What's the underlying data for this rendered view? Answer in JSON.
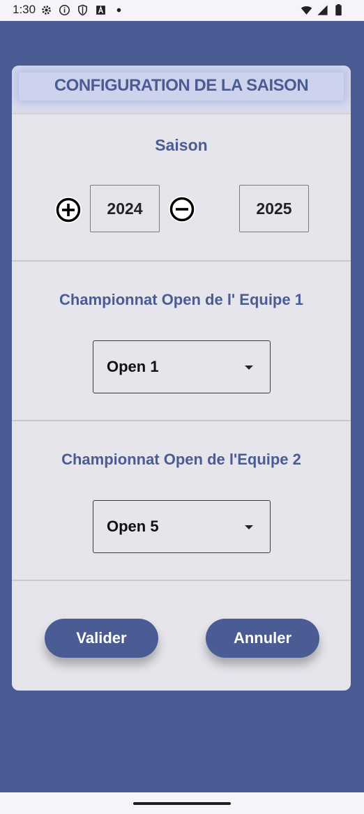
{
  "status_bar": {
    "time": "1:30",
    "left_icons": [
      "settings-icon",
      "info-icon",
      "shield-icon",
      "a-box-icon",
      "dot-icon"
    ],
    "right_icons": [
      "wifi-icon",
      "signal-icon",
      "battery-icon"
    ]
  },
  "dialog": {
    "title": "CONFIGURATION DE LA SAISON",
    "season": {
      "label": "Saison",
      "start_year": "2024",
      "end_year": "2025",
      "increment_icon": "plus-circle-icon",
      "decrement_icon": "minus-circle-icon"
    },
    "team1": {
      "label": "Championnat Open de l' Equipe 1",
      "selected": "Open 1"
    },
    "team2": {
      "label": "Championnat Open de l'Equipe 2",
      "selected": "Open 5"
    },
    "buttons": {
      "validate": "Valider",
      "cancel": "Annuler"
    }
  },
  "colors": {
    "accent": "#4a5c93",
    "dialog_background": "#e6e5ec",
    "screen_background": "#4a5c93"
  }
}
